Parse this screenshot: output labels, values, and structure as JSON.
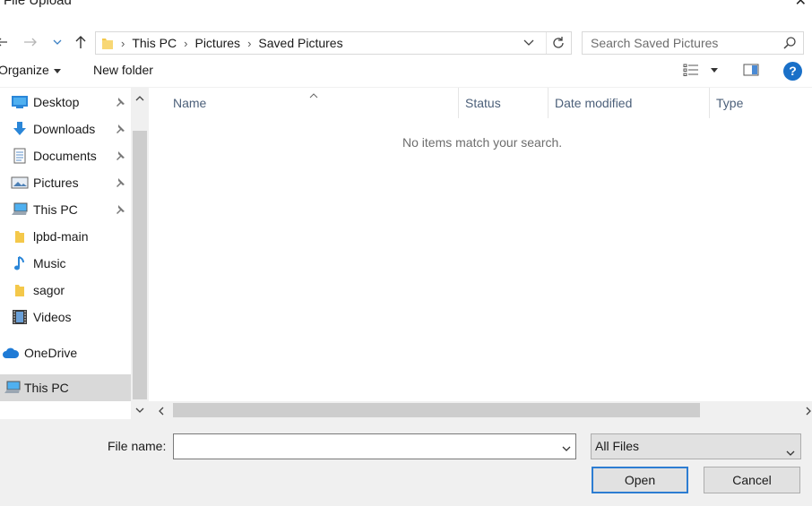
{
  "window": {
    "title": "File Upload"
  },
  "address": {
    "crumbs": [
      "This PC",
      "Pictures",
      "Saved Pictures"
    ]
  },
  "search": {
    "placeholder": "Search Saved Pictures"
  },
  "toolbar": {
    "organize_label": "Organize",
    "new_folder_label": "New folder",
    "help_label": "?"
  },
  "sidebar": {
    "items": [
      {
        "label": "Desktop",
        "icon": "desktop-icon",
        "pinned": true
      },
      {
        "label": "Downloads",
        "icon": "download-arrow-icon",
        "pinned": true
      },
      {
        "label": "Documents",
        "icon": "documents-icon",
        "pinned": true
      },
      {
        "label": "Pictures",
        "icon": "pictures-icon",
        "pinned": true
      },
      {
        "label": "This PC",
        "icon": "computer-icon",
        "pinned": true
      },
      {
        "label": "lpbd-main",
        "icon": "folder-icon",
        "pinned": false
      },
      {
        "label": "Music",
        "icon": "music-note-icon",
        "pinned": false
      },
      {
        "label": "sagor",
        "icon": "folder-icon",
        "pinned": false
      },
      {
        "label": "Videos",
        "icon": "film-icon",
        "pinned": false
      },
      {
        "label": "OneDrive",
        "icon": "cloud-icon",
        "pinned": false
      },
      {
        "label": "This PC",
        "icon": "computer-icon",
        "pinned": false,
        "selected": true
      }
    ]
  },
  "columns": [
    "Name",
    "Status",
    "Date modified",
    "Type"
  ],
  "content": {
    "empty_message": "No items match your search."
  },
  "footer": {
    "file_name_label": "File name:",
    "file_name_value": "",
    "filter_value": "All Files",
    "open_label": "Open",
    "cancel_label": "Cancel"
  },
  "colors": {
    "accent": "#2d7dd2",
    "help": "#1a70c8",
    "selected": "#d9d9d9",
    "folder": "#f4c84a"
  }
}
